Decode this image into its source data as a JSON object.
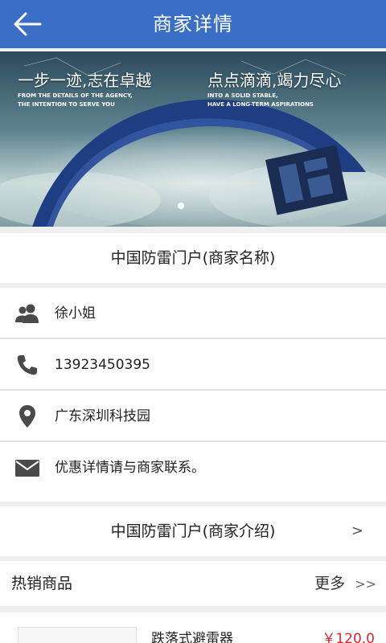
{
  "header": {
    "title": "商家详情",
    "back_icon": "arrow-left-icon"
  },
  "banner": {
    "slogan_left": "一步一迹,志在卓越",
    "sub_left_1": "FROM THE DETAILS OF THE AGENCY,",
    "sub_left_2": "THE INTENTION TO SERVE YOU",
    "slogan_right": "点点滴滴,竭力尽心",
    "sub_right_1": "INTO A SOLID STABLE,",
    "sub_right_2": "HAVE A LONG-TERM ASPIRATIONS"
  },
  "shop": {
    "name": "中国防雷门户(商家名称)"
  },
  "info": {
    "contact": "徐小姐",
    "phone": "13923450395",
    "address": "广东深圳科技园",
    "note": "优惠详情请与商家联系。"
  },
  "intro": {
    "label": "中国防雷门户(商家介绍)",
    "arrow": ">"
  },
  "hot": {
    "label": "热销商品",
    "more": "更多",
    "more_arrow": ">>"
  },
  "products": [
    {
      "name": "跌落式避雷器",
      "price": "￥120.0"
    }
  ],
  "colors": {
    "header": "#3b6fc6",
    "price": "#e0262a",
    "icon": "#4a4a4a"
  }
}
